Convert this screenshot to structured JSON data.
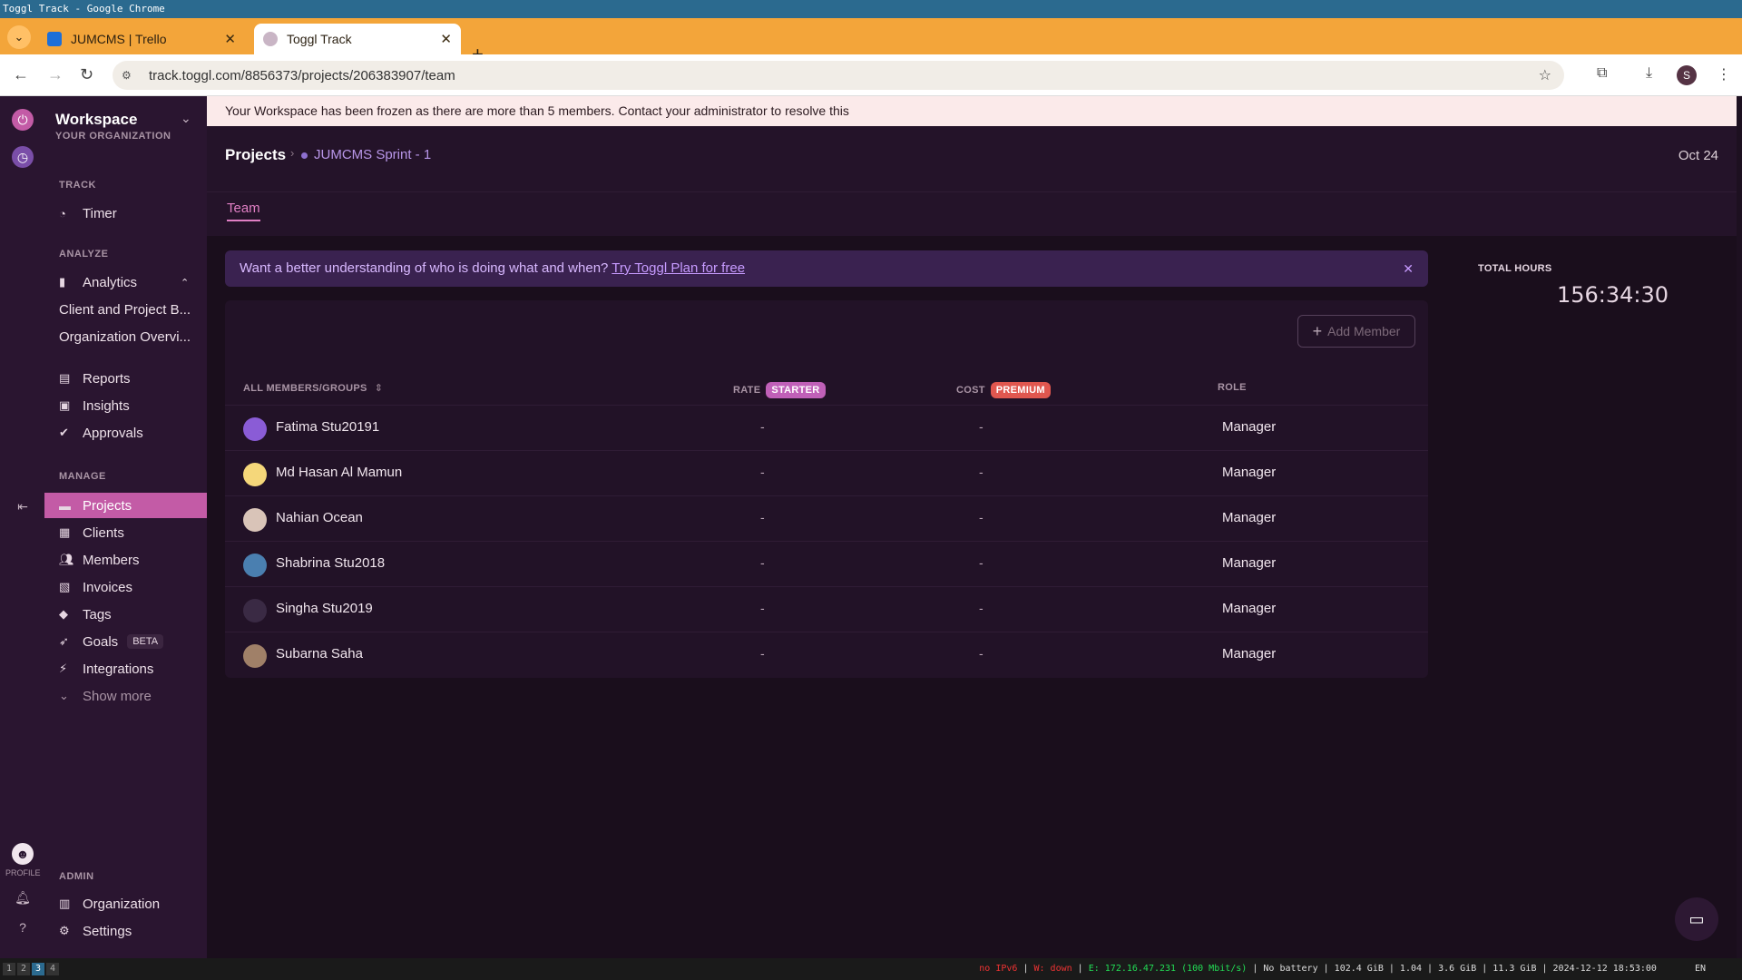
{
  "window_title": "Toggl Track - Google Chrome",
  "tabs": [
    {
      "label": "JUMCMS | Trello",
      "active": false
    },
    {
      "label": "Toggl Track",
      "active": true
    }
  ],
  "url": "track.toggl.com/8856373/projects/206383907/team",
  "profile_letter": "S",
  "sidebar": {
    "workspace_title": "Workspace",
    "workspace_sub": "YOUR ORGANIZATION",
    "sec_track": "TRACK",
    "timer": "Timer",
    "sec_analyze": "ANALYZE",
    "analytics": "Analytics",
    "client_project": "Client and Project B...",
    "org_overview": "Organization Overvi...",
    "reports": "Reports",
    "insights": "Insights",
    "approvals": "Approvals",
    "sec_manage": "MANAGE",
    "projects": "Projects",
    "clients": "Clients",
    "members": "Members",
    "invoices": "Invoices",
    "tags": "Tags",
    "goals": "Goals",
    "goals_badge": "BETA",
    "integrations": "Integrations",
    "show_more": "Show more",
    "sec_admin": "ADMIN",
    "organization": "Organization",
    "settings": "Settings",
    "profile_label": "PROFILE"
  },
  "banner": "Your Workspace has been frozen as there are more than 5 members. Contact your administrator to resolve this",
  "header": {
    "crumb_root": "Projects",
    "crumb_project": "JUMCMS Sprint - 1",
    "date": "Oct 24",
    "tab_team": "Team"
  },
  "promo": {
    "text": "Want a better understanding of who is doing what and when?",
    "link": "Try Toggl Plan for free"
  },
  "table": {
    "add_member": "Add Member",
    "col_members": "ALL MEMBERS/GROUPS",
    "col_rate": "RATE",
    "rate_badge": "STARTER",
    "col_cost": "COST",
    "cost_badge": "PREMIUM",
    "col_role": "ROLE",
    "rows": [
      {
        "name": "Fatima Stu20191",
        "rate": "-",
        "cost": "-",
        "role": "Manager",
        "avatar_color": "#8a5cd6"
      },
      {
        "name": "Md Hasan Al Mamun",
        "rate": "-",
        "cost": "-",
        "role": "Manager",
        "avatar_color": "#f5d77a"
      },
      {
        "name": "Nahian Ocean",
        "rate": "-",
        "cost": "-",
        "role": "Manager",
        "avatar_color": "#d9c4b8"
      },
      {
        "name": "Shabrina Stu2018",
        "rate": "-",
        "cost": "-",
        "role": "Manager",
        "avatar_color": "#4a7fb0"
      },
      {
        "name": "Singha Stu2019",
        "rate": "-",
        "cost": "-",
        "role": "Manager",
        "avatar_color": "#3a2a44"
      },
      {
        "name": "Subarna Saha",
        "rate": "-",
        "cost": "-",
        "role": "Manager",
        "avatar_color": "#a08068"
      }
    ]
  },
  "total_hours_label": "TOTAL HOURS",
  "total_hours": "156:34:30",
  "statusbar": {
    "workspaces": [
      "1",
      "2",
      "3",
      "4"
    ],
    "ipv6": "no IPv6",
    "wifi": "W: down",
    "eth": "E: 172.16.47.231 (100 Mbit/s)",
    "battery": "No battery",
    "disk": "102.4 GiB",
    "load": "1.04",
    "mem": "3.6 GiB",
    "swap": "11.3 GiB",
    "datetime": "2024-12-12 18:53:00",
    "lang": "EN"
  }
}
